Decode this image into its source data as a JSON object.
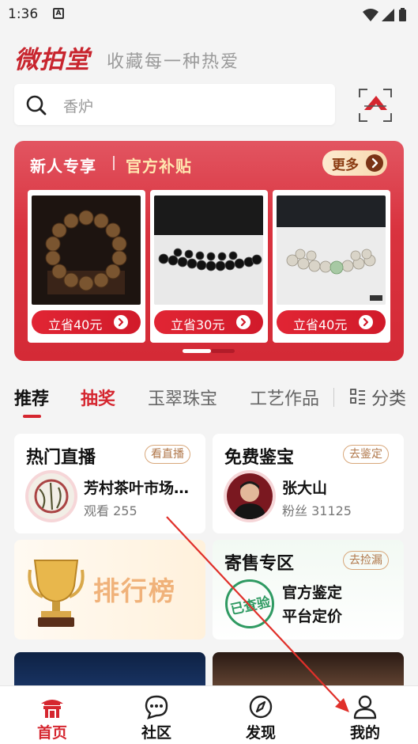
{
  "status_bar": {
    "time": "1:36",
    "notification_glyph": "A"
  },
  "brand": {
    "logo": "微拍堂",
    "slogan": "收藏每一种热爱"
  },
  "search": {
    "placeholder": "香炉"
  },
  "promo": {
    "title": "新人专享",
    "subtitle": "官方补贴",
    "more_label": "更多",
    "items": [
      {
        "save_label": "立省40元"
      },
      {
        "save_label": "立省30元"
      },
      {
        "save_label": "立省40元"
      }
    ]
  },
  "tabs": {
    "items": [
      {
        "label": "推荐"
      },
      {
        "label": "抽奖"
      },
      {
        "label": "玉翠珠宝"
      },
      {
        "label": "工艺作品"
      }
    ],
    "category_label": "分类"
  },
  "tiles": {
    "live": {
      "title": "热门直播",
      "tag": "看直播",
      "name": "芳村茶叶市场…",
      "meta": "观看 255"
    },
    "appraisal": {
      "title": "免费鉴宝",
      "tag": "去鉴定",
      "name": "张大山",
      "meta": "粉丝 31125"
    },
    "ranking": {
      "title": "排行榜"
    },
    "consign": {
      "title": "寄售专区",
      "tag": "去捡漏",
      "line1": "官方鉴定",
      "line2": "平台定价",
      "stamp": "已查验"
    }
  },
  "bottom_nav": {
    "items": [
      {
        "label": "首页",
        "icon": "home-pavilion-icon"
      },
      {
        "label": "社区",
        "icon": "chat-bubble-icon"
      },
      {
        "label": "发现",
        "icon": "compass-icon"
      },
      {
        "label": "我的",
        "icon": "person-icon"
      }
    ]
  },
  "colors": {
    "brand_red": "#d5262f",
    "promo_red": "#d9333f",
    "gold_text": "#ffe7b0",
    "tag_brown": "#b0774a",
    "stamp_green": "#2f9a62"
  }
}
